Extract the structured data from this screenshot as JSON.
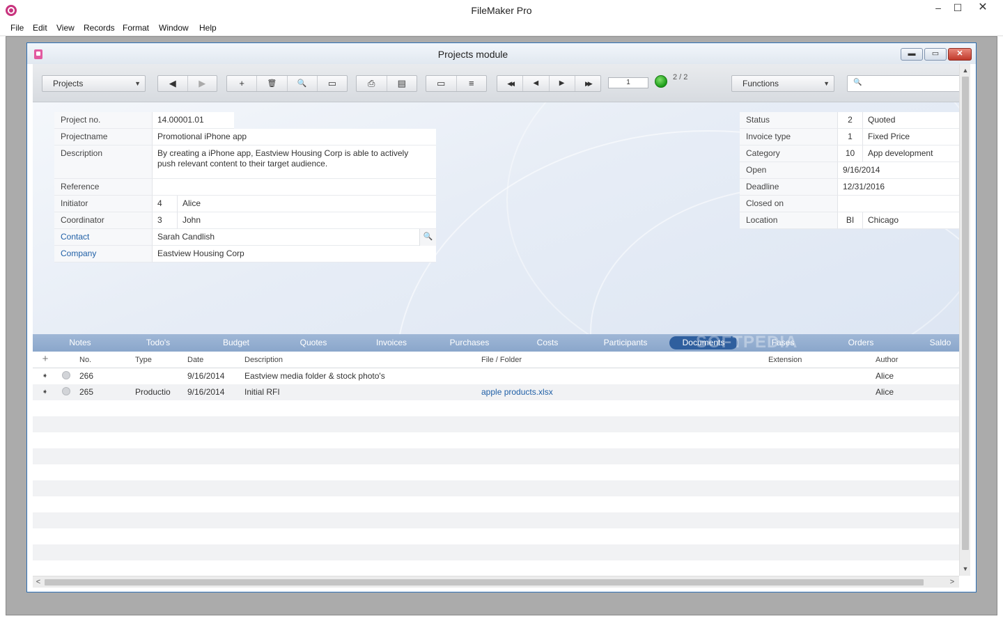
{
  "app": {
    "title": "FileMaker Pro",
    "min": "–",
    "max": "☐",
    "close": "✕"
  },
  "menu": [
    "File",
    "Edit",
    "View",
    "Records",
    "Format",
    "Window",
    "Help"
  ],
  "window": {
    "title": "Projects module",
    "min": "▬",
    "restore": "▭",
    "close": "✕"
  },
  "toolbar": {
    "layout_menu": "Projects",
    "functions_menu": "Functions",
    "record_number": "1",
    "record_count": "2 / 2",
    "search_placeholder": "",
    "icons": {
      "prev": "◀",
      "next": "▶",
      "new": "+",
      "delete": "🗑",
      "find": "🔍",
      "sort": "▭",
      "print": "⎙",
      "export": "▤",
      "form_view": "▭",
      "list_view": "≡",
      "first": "◀◀",
      "prev_record": "◀",
      "next_record": "▶",
      "last": "▶▶",
      "search": "🔍",
      "dropdown": "▼"
    }
  },
  "form": {
    "left": [
      {
        "label": "Project no.",
        "value": "14.00001.01"
      },
      {
        "label": "Projectname",
        "value": "Promotional iPhone app"
      },
      {
        "label": "Description",
        "value": "By creating a iPhone app, Eastview Housing Corp is able to actively push relevant content to their target audience."
      },
      {
        "label": "Reference",
        "value": ""
      },
      {
        "label": "Initiator",
        "code": "4",
        "value": "Alice"
      },
      {
        "label": "Coordinator",
        "code": "3",
        "value": "John"
      },
      {
        "label": "Contact",
        "value": "Sarah Candlish"
      },
      {
        "label": "Company",
        "value": "Eastview Housing Corp"
      }
    ],
    "right": [
      {
        "label": "Status",
        "code": "2",
        "value": "Quoted"
      },
      {
        "label": "Invoice type",
        "code": "1",
        "value": "Fixed Price"
      },
      {
        "label": "Category",
        "code": "10",
        "value": "App development"
      },
      {
        "label": "Open",
        "value": "9/16/2014"
      },
      {
        "label": "Deadline",
        "value": "12/31/2016"
      },
      {
        "label": "Closed on",
        "value": ""
      },
      {
        "label": "Location",
        "code": "BI",
        "value": "Chicago"
      }
    ]
  },
  "tabs": [
    "Notes",
    "Todo's",
    "Budget",
    "Quotes",
    "Invoices",
    "Purchases",
    "Costs",
    "Participants",
    "Documents",
    "Fases",
    "Orders",
    "Saldo"
  ],
  "active_tab": "Documents",
  "watermark": "SOFTPEDIA",
  "list": {
    "add_label": "+",
    "row_arrow": "➧",
    "columns": [
      "No.",
      "Type",
      "Date",
      "Description",
      "File / Folder",
      "Extension",
      "Author"
    ],
    "rows": [
      {
        "no": "266",
        "type": "",
        "date": "9/16/2014",
        "description": "Eastview media folder & stock photo's",
        "file": "",
        "extension": "",
        "author": "Alice"
      },
      {
        "no": "265",
        "type": "Productio",
        "date": "9/16/2014",
        "description": "Initial RFI",
        "file": "apple products.xlsx",
        "extension": "",
        "author": "Alice"
      }
    ]
  },
  "scroll": {
    "up": "▲",
    "down": "▼",
    "left": "<",
    "right": ">"
  }
}
